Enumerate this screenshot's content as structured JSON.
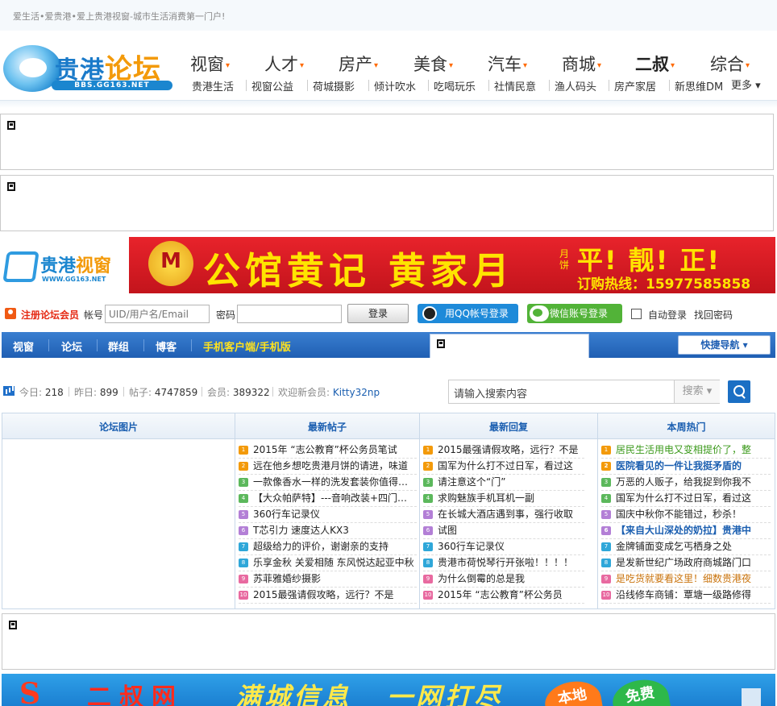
{
  "topbar": {
    "slogan": "爱生活•爱贵港•爱上贵港视窗-城市生活消费第一门户!"
  },
  "logo": {
    "name1": "贵港",
    "name2": "论坛",
    "url": "BBS.GG163.NET"
  },
  "mainnav": [
    {
      "label": "视窗",
      "caret": "▾"
    },
    {
      "label": "人才",
      "caret": "▾"
    },
    {
      "label": "房产",
      "caret": "▾"
    },
    {
      "label": "美食",
      "caret": "▾"
    },
    {
      "label": "汽车",
      "caret": "▾"
    },
    {
      "label": "商城",
      "caret": "▾"
    },
    {
      "label": "二叔",
      "caret": "▾"
    },
    {
      "label": "综合",
      "caret": "▾"
    }
  ],
  "subnav": [
    "贵港生活",
    "视窗公益",
    "荷城摄影",
    "倾计吹水",
    "吃喝玩乐",
    "社情民意",
    "渔人码头",
    "房产家居",
    "新思维DM"
  ],
  "subnav_more": "更多 ▾",
  "vlogo": {
    "name1": "贵港",
    "name2": "视窗",
    "url": "WWW.GG163.NET"
  },
  "banner1": {
    "big": "公馆黄记 黄家月",
    "small": "月饼",
    "slogan": "平! 靓! 正!",
    "hotline": "订购热线：15977585858"
  },
  "login": {
    "register": "注册论坛会员",
    "account_label": "帐号",
    "account_placeholder": "UID/用户名/Email",
    "password_label": "密码",
    "submit": "登录",
    "qq": "用QQ帐号登录",
    "wechat": "微信账号登录",
    "auto": "自动登录",
    "find": "找回密码"
  },
  "bluebar": {
    "items": [
      "视窗",
      "论坛",
      "群组",
      "博客"
    ],
    "mobile": "手机客户端/手机版",
    "quick": "快捷导航 ▾"
  },
  "stats": {
    "today_label": "今日:",
    "today": "218",
    "yesterday_label": "昨日:",
    "yesterday": "899",
    "posts_label": "帖子:",
    "posts": "4747859",
    "members_label": "会员:",
    "members": "389322",
    "newest_label": "欢迎新会员:",
    "newest": "Kitty32np",
    "search_placeholder": "请输入搜索内容",
    "search_type": "搜索 ▾"
  },
  "board": {
    "titles": [
      "论坛图片",
      "最新帖子",
      "最新回复",
      "本周热门"
    ],
    "latest_posts": [
      "2015年 “志公教育”杯公务员笔试",
      "远在他乡想吃贵港月饼的请进，味道",
      "一款像香水一样的洗发套装你值得拥有",
      "【大众帕萨特】---音响改装+四门隔音",
      "360行车记录仪",
      "T芯引力 速度达人KX3",
      "超级给力的评价，谢谢亲的支持",
      "乐享金秋 关爱相随 东风悦达起亚中秋",
      "苏菲雅婚纱摄影",
      "2015最强请假攻略，远行？不是"
    ],
    "latest_replies": [
      "2015最强请假攻略，远行？不是",
      "国军为什么打不过日军，看过这",
      "请注意这个“门”",
      "求购魅族手机耳机一副",
      "在长城大酒店遇到事，强行收取",
      "试图",
      "360行车记录仪",
      "贵港市荷悦琴行开张啦！！！！",
      "为什么倒霉的总是我",
      "2015年 “志公教育”杯公务员"
    ],
    "weekly_hot": [
      "居民生活用电又变相提价了，整",
      "医院看见的一件让我挺矛盾的",
      "万恶的人贩子，给我捉到你我不",
      "国军为什么打不过日军，看过这",
      "国庆中秋你不能错过，秒杀！",
      "【来自大山深处的奶拉】贵港中",
      "金牌铺面变成乞丐栖身之处",
      "是发新世纪广场政府商城路门口",
      "是吃货就要看这里！细数贵港夜",
      "沿线修车商铺：覃塘一级路修得"
    ],
    "weekly_styles": [
      "green",
      "blue",
      "",
      "",
      "",
      "blue",
      "",
      "",
      "orange",
      ""
    ],
    "num_colors": [
      "#f39a0a",
      "#f39a0a",
      "#5cb85c",
      "#5cb85c",
      "#b37fd6",
      "#b37fd6",
      "#2fa7d9",
      "#2fa7d9",
      "#e86aa0",
      "#e86aa0"
    ]
  },
  "banner2": {
    "s1": "S",
    "s2": "二叔网",
    "s3": "满城信息",
    "s4": "一网打尽",
    "b1": "本地",
    "b2": "免费"
  }
}
